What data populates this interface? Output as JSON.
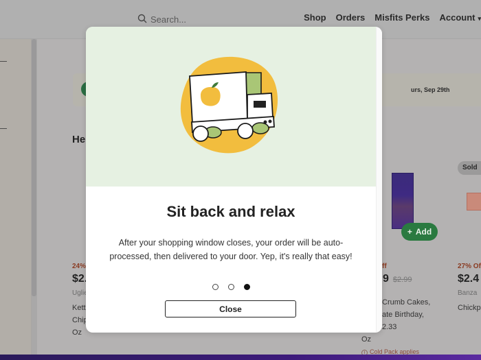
{
  "header": {
    "search_placeholder": "Search...",
    "nav": [
      "Shop",
      "Orders",
      "Misfits Perks",
      "Account"
    ],
    "account_caret": "▾"
  },
  "banner": {
    "text": "urs, Sep 29th"
  },
  "section": {
    "title": "He"
  },
  "products": [
    {
      "discount": "24%",
      "price": "$2.",
      "old_price": "",
      "brand": "Uglie",
      "name_lines": [
        "Kett",
        "Chip",
        "Oz"
      ]
    },
    {
      "discount": "ff",
      "price": "9",
      "old_price": "$2.99",
      "brand": "",
      "name_lines": [
        "Crumb Cakes,",
        "ate Birthday, 2.33",
        "Oz"
      ],
      "cold_pack": "Cold Pack applies",
      "add_label": "Add"
    },
    {
      "discount": "27% Of",
      "price": "$2.4",
      "brand": "Banza",
      "name_lines": [
        "Chickp"
      ],
      "badge": "Sold"
    }
  ],
  "modal": {
    "title": "Sit back and relax",
    "body": "After your shopping window closes, your order will be auto-processed, then delivered to your door. Yep, it's really that easy!",
    "pagination": {
      "total": 3,
      "current": 3
    },
    "close_label": "Close",
    "illustration": "delivery-truck-illustration",
    "colors": {
      "hero_bg": "#e6f1e2",
      "blob": "#f2bd3e",
      "truck_green": "#a9c676"
    }
  }
}
